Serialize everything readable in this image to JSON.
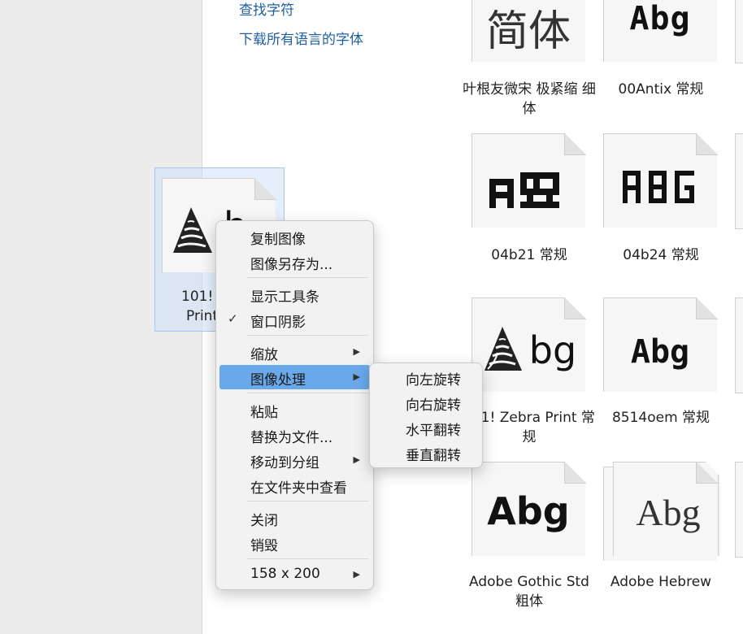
{
  "sidebar": {
    "links": [
      "查找字符",
      "下载所有语言的字体"
    ]
  },
  "fonts": [
    {
      "name": "叶根友微宋 极紧缩 细体",
      "sample": "简体"
    },
    {
      "name": "00Antix 常规",
      "sample": "Abg"
    },
    {
      "name": "04b21 常规",
      "sample": "AR"
    },
    {
      "name": "04b24 常规",
      "sample": "ABG"
    },
    {
      "name": "101! Zebra Print 常规",
      "sample": "Abg"
    },
    {
      "name": "8514oem 常规",
      "sample": "Abg"
    },
    {
      "name": "Adobe Gothic Std 粗体",
      "sample": "Abg"
    },
    {
      "name": "Adobe Hebrew",
      "sample": "Abg"
    }
  ],
  "selected_tile": {
    "label_line1": "101!",
    "label_line2": "Print"
  },
  "context_menu": {
    "items": {
      "copy": "复制图像",
      "save_as": "图像另存为...",
      "toolbar": "显示工具条",
      "shadow": "窗口阴影",
      "zoom": "缩放",
      "image": "图像处理",
      "paste": "粘贴",
      "replace": "替换为文件...",
      "move": "移动到分组",
      "reveal": "在文件夹中查看",
      "close": "关闭",
      "destroy": "销毁",
      "size": "158 x 200"
    },
    "checked": "shadow",
    "highlighted": "image"
  },
  "submenu": {
    "items": [
      "向左旋转",
      "向右旋转",
      "水平翻转",
      "垂直翻转"
    ]
  },
  "colors": {
    "highlight": "#6aa9e9",
    "link": "#1f5fa8",
    "selection": "#cde1f8"
  }
}
